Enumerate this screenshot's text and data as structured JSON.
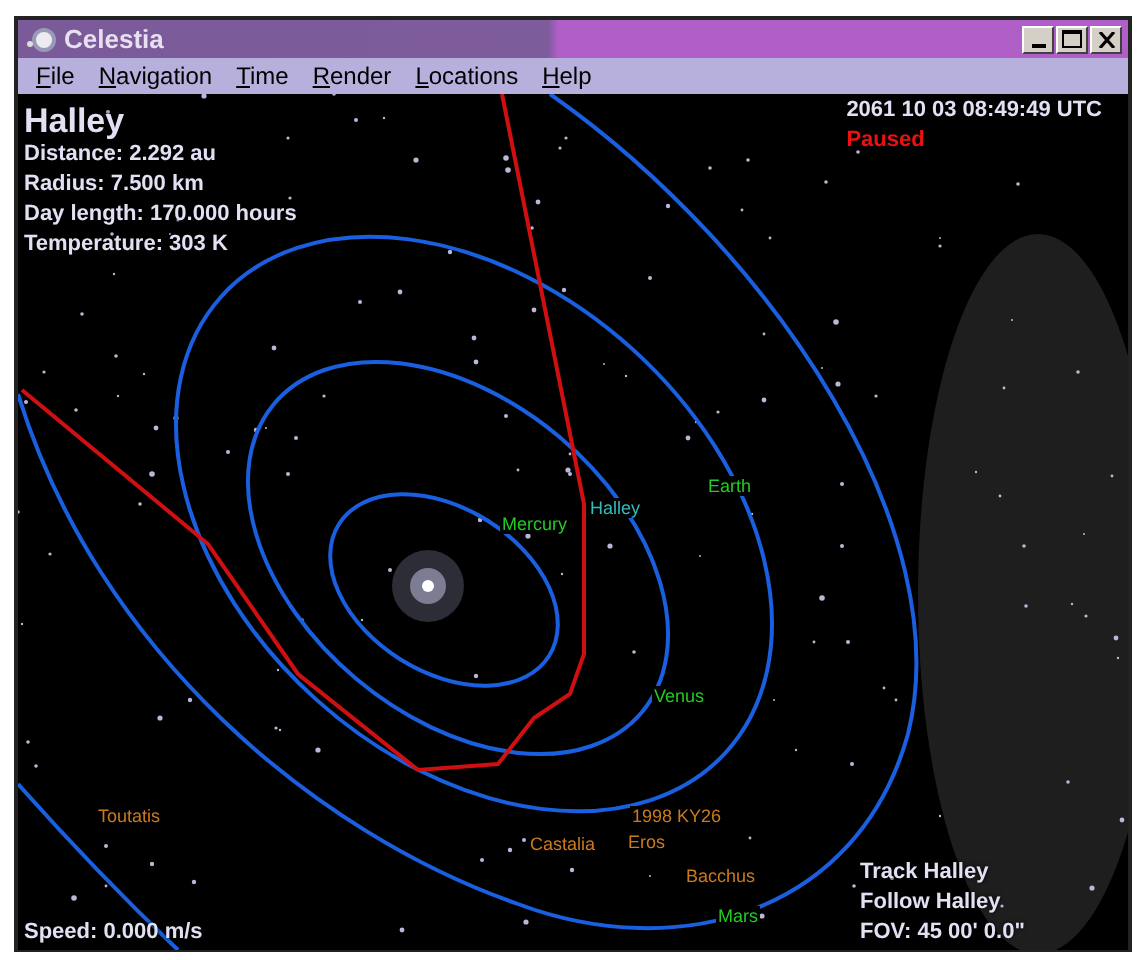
{
  "window": {
    "title": "Celestia"
  },
  "menu": [
    {
      "label": "File"
    },
    {
      "label": "Navigation"
    },
    {
      "label": "Time"
    },
    {
      "label": "Render"
    },
    {
      "label": "Locations"
    },
    {
      "label": "Help"
    }
  ],
  "selection": {
    "name": "Halley",
    "details": [
      "Distance: 2.292 au",
      "Radius: 7.500 km",
      "Day length: 170.000 hours",
      "Temperature: 303 K"
    ]
  },
  "time": {
    "date": "2061 10 03 08:49:49 UTC",
    "status": "Paused"
  },
  "labels": [
    {
      "text": "Mercury",
      "color": "#22cc22"
    },
    {
      "text": "Halley",
      "color": "#33bbbb"
    },
    {
      "text": "Earth",
      "color": "#22cc22"
    },
    {
      "text": "Venus",
      "color": "#22cc22"
    },
    {
      "text": "Toutatis",
      "color": "#cc7a1e"
    },
    {
      "text": "1998 KY26",
      "color": "#cc7a1e"
    },
    {
      "text": "Castalia",
      "color": "#cc7a1e"
    },
    {
      "text": "Eros",
      "color": "#cc7a1e"
    },
    {
      "text": "Bacchus",
      "color": "#cc7a1e"
    },
    {
      "text": "Mars",
      "color": "#22cc22"
    }
  ],
  "speed": "Speed: 0.000 m/s",
  "tracking": [
    "Track Halley",
    "Follow Halley",
    "FOV: 45 00' 0.0\""
  ]
}
